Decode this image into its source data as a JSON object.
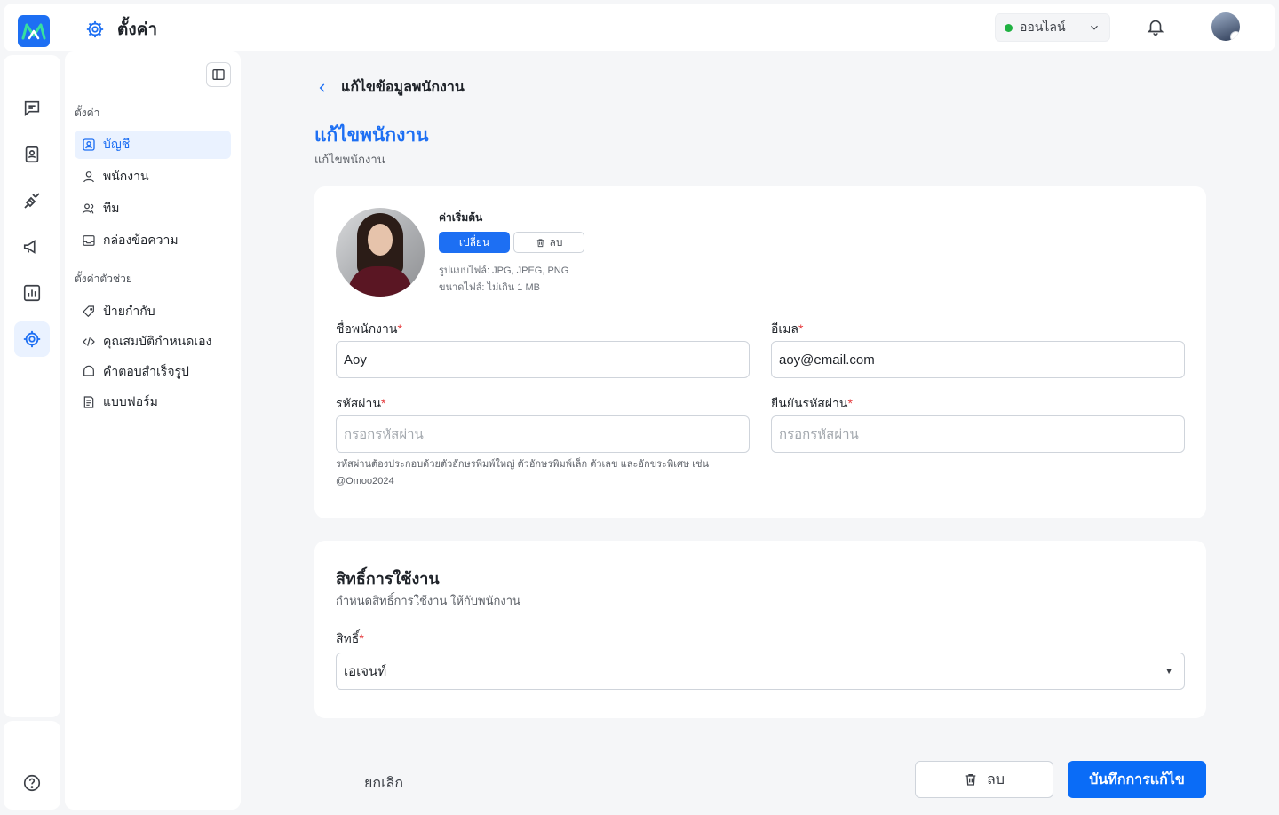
{
  "header": {
    "title": "ตั้งค่า",
    "status_label": "ออนไลน์",
    "status_color": "#1fb141"
  },
  "rail": {
    "items": [
      {
        "icon": "chat-icon"
      },
      {
        "icon": "contacts-icon"
      },
      {
        "icon": "plug-icon"
      },
      {
        "icon": "megaphone-icon"
      },
      {
        "icon": "chart-icon"
      },
      {
        "icon": "gear-icon",
        "active": true
      }
    ],
    "help_icon": "help-icon"
  },
  "subnav": {
    "section1": "ตั้งค่า",
    "items1": [
      {
        "label": "บัญชี",
        "icon": "account-icon",
        "active": true
      },
      {
        "label": "พนักงาน",
        "icon": "user-icon"
      },
      {
        "label": "ทีม",
        "icon": "team-icon"
      },
      {
        "label": "กล่องข้อความ",
        "icon": "inbox-icon"
      }
    ],
    "section2": "ตั้งค่าตัวช่วย",
    "items2": [
      {
        "label": "ป้ายกำกับ",
        "icon": "tag-icon"
      },
      {
        "label": "คุณสมบัติกำหนดเอง",
        "icon": "code-icon"
      },
      {
        "label": "คำตอบสำเร็จรูป",
        "icon": "canned-reply-icon"
      },
      {
        "label": "แบบฟอร์ม",
        "icon": "form-icon"
      }
    ]
  },
  "main": {
    "back_label": "แก้ไขข้อมูลพนักงาน",
    "title": "แก้ไขพนักงาน",
    "subtitle": "แก้ไขพนักงาน",
    "photo": {
      "heading": "ค่าเริ่มต้น",
      "change_label": "เปลี่ยน",
      "remove_label": "ลบ",
      "hint_type": "รูปแบบไฟล์: JPG, JPEG, PNG",
      "hint_size": "ขนาดไฟล์: ไม่เกิน 1 MB"
    },
    "fields": {
      "name_label": "ชื่อพนักงาน",
      "name_value": "Aoy",
      "email_label": "อีเมล",
      "email_value": "aoy@email.com",
      "password_label": "รหัสผ่าน",
      "password_placeholder": "กรอกรหัสผ่าน",
      "confirm_label": "ยืนยันรหัสผ่าน",
      "confirm_placeholder": "กรอกรหัสผ่าน",
      "required_mark": "*",
      "password_hint": "รหัสผ่านต้องประกอบด้วยตัวอักษรพิมพ์ใหญ่ ตัวอักษรพิมพ์เล็ก ตัวเลข และอักขระพิเศษ เช่น @Omoo2024"
    },
    "permission": {
      "title": "สิทธิ์การใช้งาน",
      "subtitle": "กำหนดสิทธิ์การใช้งาน ให้กับพนักงาน",
      "role_label": "สิทธิ์",
      "role_value": "เอเจนท์"
    },
    "actions": {
      "cancel": "ยกเลิก",
      "delete": "ลบ",
      "save": "บันทึกการแก้ไข"
    }
  },
  "colors": {
    "accent": "#1d6ff3",
    "required": "#e5383b"
  }
}
